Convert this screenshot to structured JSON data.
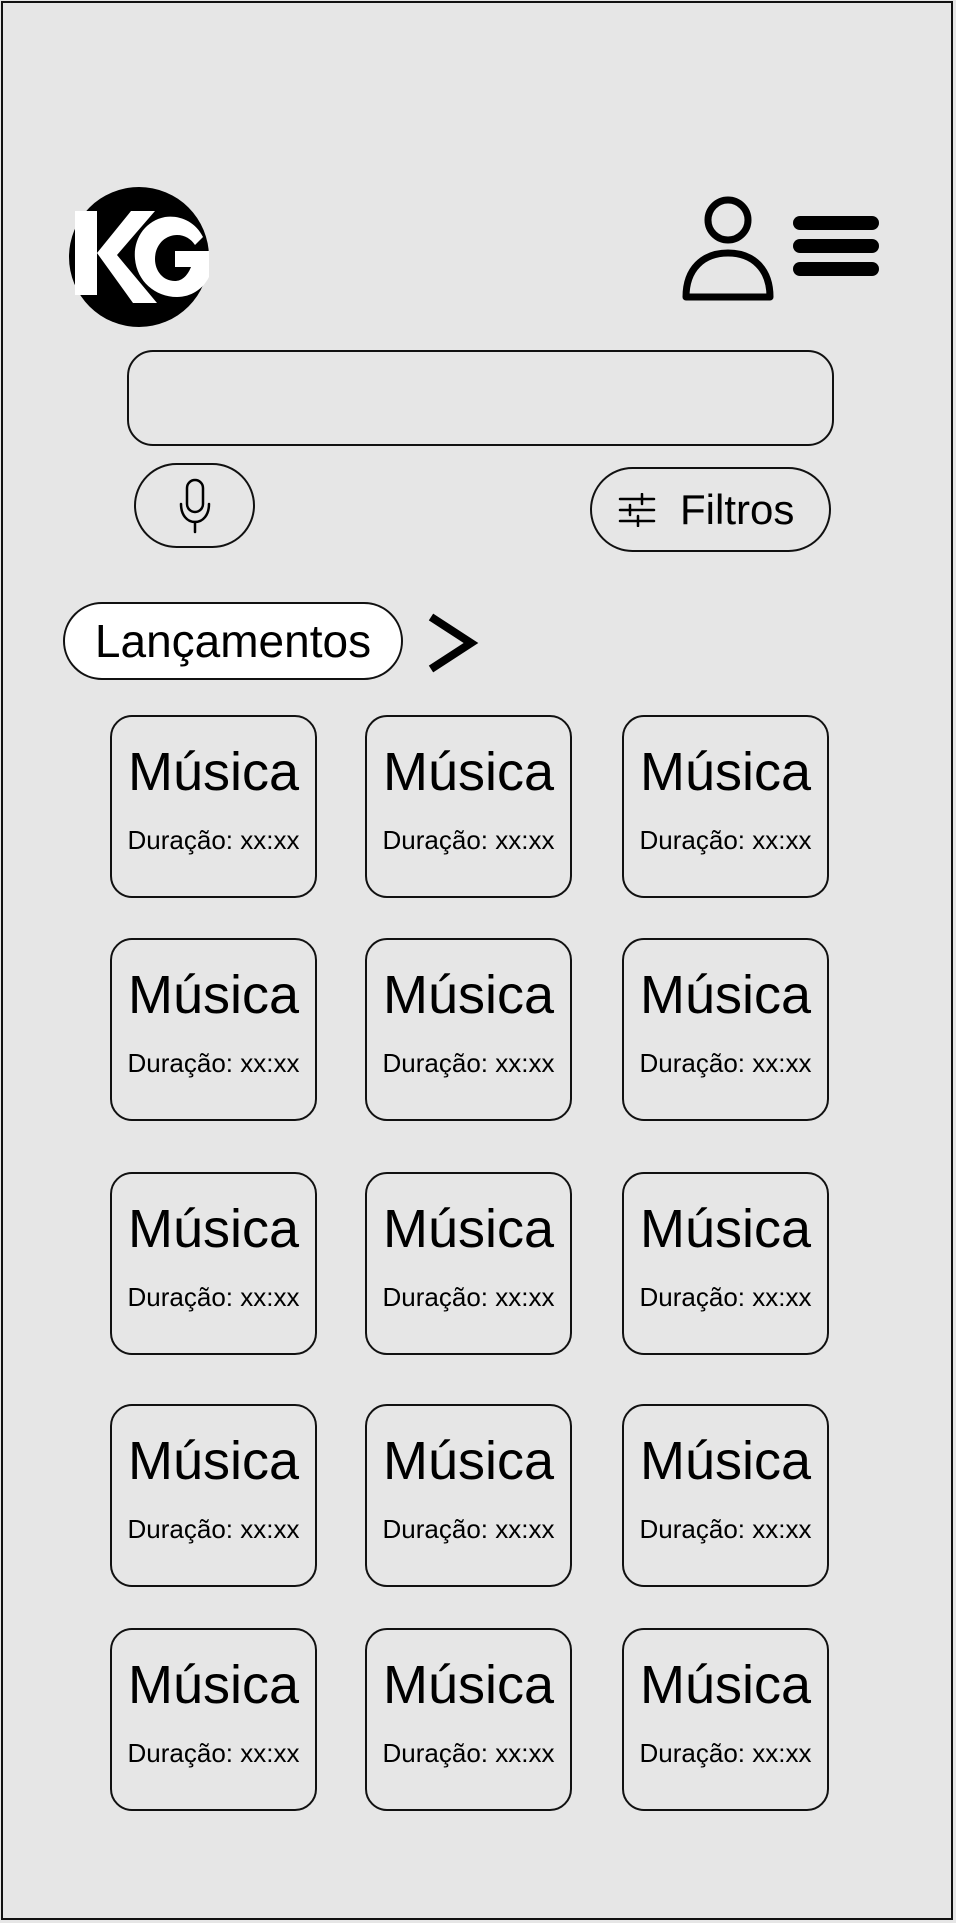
{
  "header": {
    "logo_text": "KG",
    "profile_icon": "user-icon",
    "menu_icon": "hamburger-menu-icon"
  },
  "search": {
    "value": "",
    "placeholder": ""
  },
  "voice_button": {
    "icon": "microphone-icon"
  },
  "filters_button": {
    "icon": "sliders-icon",
    "label": "Filtros"
  },
  "section": {
    "title": "Lançamentos",
    "more_icon": "chevron-right-icon"
  },
  "tracks": [
    {
      "title": "Música",
      "duration": "Duração: xx:xx"
    },
    {
      "title": "Música",
      "duration": "Duração: xx:xx"
    },
    {
      "title": "Música",
      "duration": "Duração: xx:xx"
    },
    {
      "title": "Música",
      "duration": "Duração: xx:xx"
    },
    {
      "title": "Música",
      "duration": "Duração: xx:xx"
    },
    {
      "title": "Música",
      "duration": "Duração: xx:xx"
    },
    {
      "title": "Música",
      "duration": "Duração: xx:xx"
    },
    {
      "title": "Música",
      "duration": "Duração: xx:xx"
    },
    {
      "title": "Música",
      "duration": "Duração: xx:xx"
    },
    {
      "title": "Música",
      "duration": "Duração: xx:xx"
    },
    {
      "title": "Música",
      "duration": "Duração: xx:xx"
    },
    {
      "title": "Música",
      "duration": "Duração: xx:xx"
    },
    {
      "title": "Música",
      "duration": "Duração: xx:xx"
    },
    {
      "title": "Música",
      "duration": "Duração: xx:xx"
    },
    {
      "title": "Música",
      "duration": "Duração: xx:xx"
    }
  ]
}
